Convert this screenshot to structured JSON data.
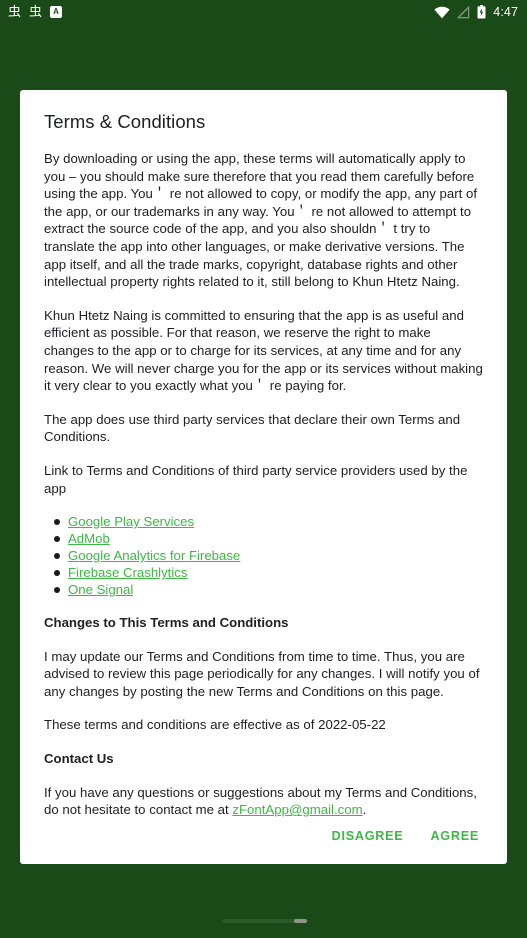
{
  "status_bar": {
    "notifications": [
      {
        "name": "app-notification-icon-1",
        "glyph": "虫"
      },
      {
        "name": "app-notification-icon-2",
        "glyph": "虫"
      }
    ],
    "badge_letter": "A",
    "time": "4:47",
    "icons": [
      "wifi-icon",
      "signal-off-icon",
      "battery-charging-icon"
    ]
  },
  "dialog": {
    "title": "Terms & Conditions",
    "paragraphs": {
      "p1": "By downloading or using the app, these terms will automatically apply to you – you should make sure therefore that you read them carefully before using the app. You＇ re not allowed to copy, or modify the app, any part of the app, or our trademarks in any way. You＇ re not allowed to attempt to extract the source code of the app, and you also shouldn＇ t try to translate the app into other languages, or make derivative versions. The app itself, and all the trade marks, copyright, database rights and other intellectual property rights related to it, still belong to Khun Htetz Naing.",
      "p2": "Khun Htetz Naing is committed to ensuring that the app is as useful and efficient as possible. For that reason, we reserve the right to make changes to the app or to charge for its services, at any time and for any reason. We will never charge you for the app or its services without making it very clear to you exactly what you＇ re paying for.",
      "p3": "The app does use third party services that declare their own Terms and Conditions.",
      "p4": "Link to Terms and Conditions of third party service providers used by the app",
      "changes_heading": "Changes to This Terms and Conditions",
      "p5": "I may update our Terms and Conditions from time to time. Thus, you are advised to review this page periodically for any changes. I will notify you of any changes by posting the new Terms and Conditions on this page.",
      "p6": "These terms and conditions are effective as of 2022-05-22",
      "contact_heading": "Contact Us",
      "p7_before": "If you have any questions or suggestions about my Terms and Conditions, do not hesitate to contact me at ",
      "p7_email": "zFontApp@gmail.com",
      "p7_after": "."
    },
    "service_links": [
      "Google Play Services",
      "AdMob",
      "Google Analytics for Firebase",
      "Firebase Crashlytics",
      "One Signal"
    ],
    "actions": {
      "disagree": "DISAGREE",
      "agree": "AGREE"
    }
  },
  "colors": {
    "background": "#1a4a17",
    "dialog_background": "#ffffff",
    "link_green": "#3cb843",
    "text": "#202124",
    "status_text": "#ffffff"
  }
}
